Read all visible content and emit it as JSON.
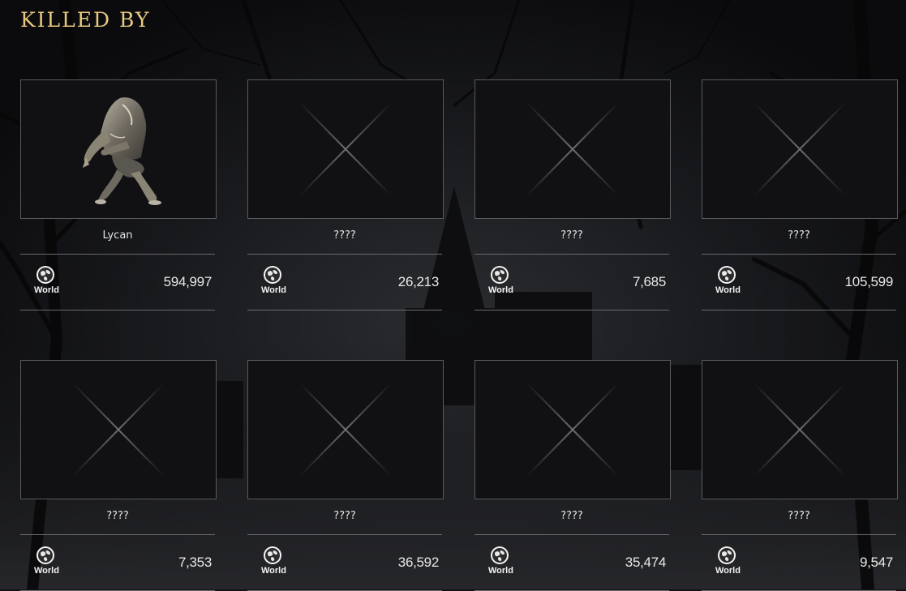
{
  "page": {
    "title": "KILLED BY"
  },
  "colors": {
    "title": "#e7c97f",
    "card_border": "#595a5e",
    "divider": "#6a6a6e",
    "text": "#e4e4e4"
  },
  "cards": [
    {
      "name": "Lycan",
      "region": "World",
      "count": "594,997",
      "image": "lycan-portrait",
      "revealed": true
    },
    {
      "name": "????",
      "region": "World",
      "count": "26,213",
      "image": "locked-x",
      "revealed": false
    },
    {
      "name": "????",
      "region": "World",
      "count": "7,685",
      "image": "locked-x",
      "revealed": false
    },
    {
      "name": "????",
      "region": "World",
      "count": "105,599",
      "image": "locked-x",
      "revealed": false
    },
    {
      "name": "????",
      "region": "World",
      "count": "7,353",
      "image": "locked-x",
      "revealed": false
    },
    {
      "name": "????",
      "region": "World",
      "count": "36,592",
      "image": "locked-x",
      "revealed": false
    },
    {
      "name": "????",
      "region": "World",
      "count": "35,474",
      "image": "locked-x",
      "revealed": false
    },
    {
      "name": "????",
      "region": "World",
      "count": "9,547",
      "image": "locked-x",
      "revealed": false
    }
  ]
}
